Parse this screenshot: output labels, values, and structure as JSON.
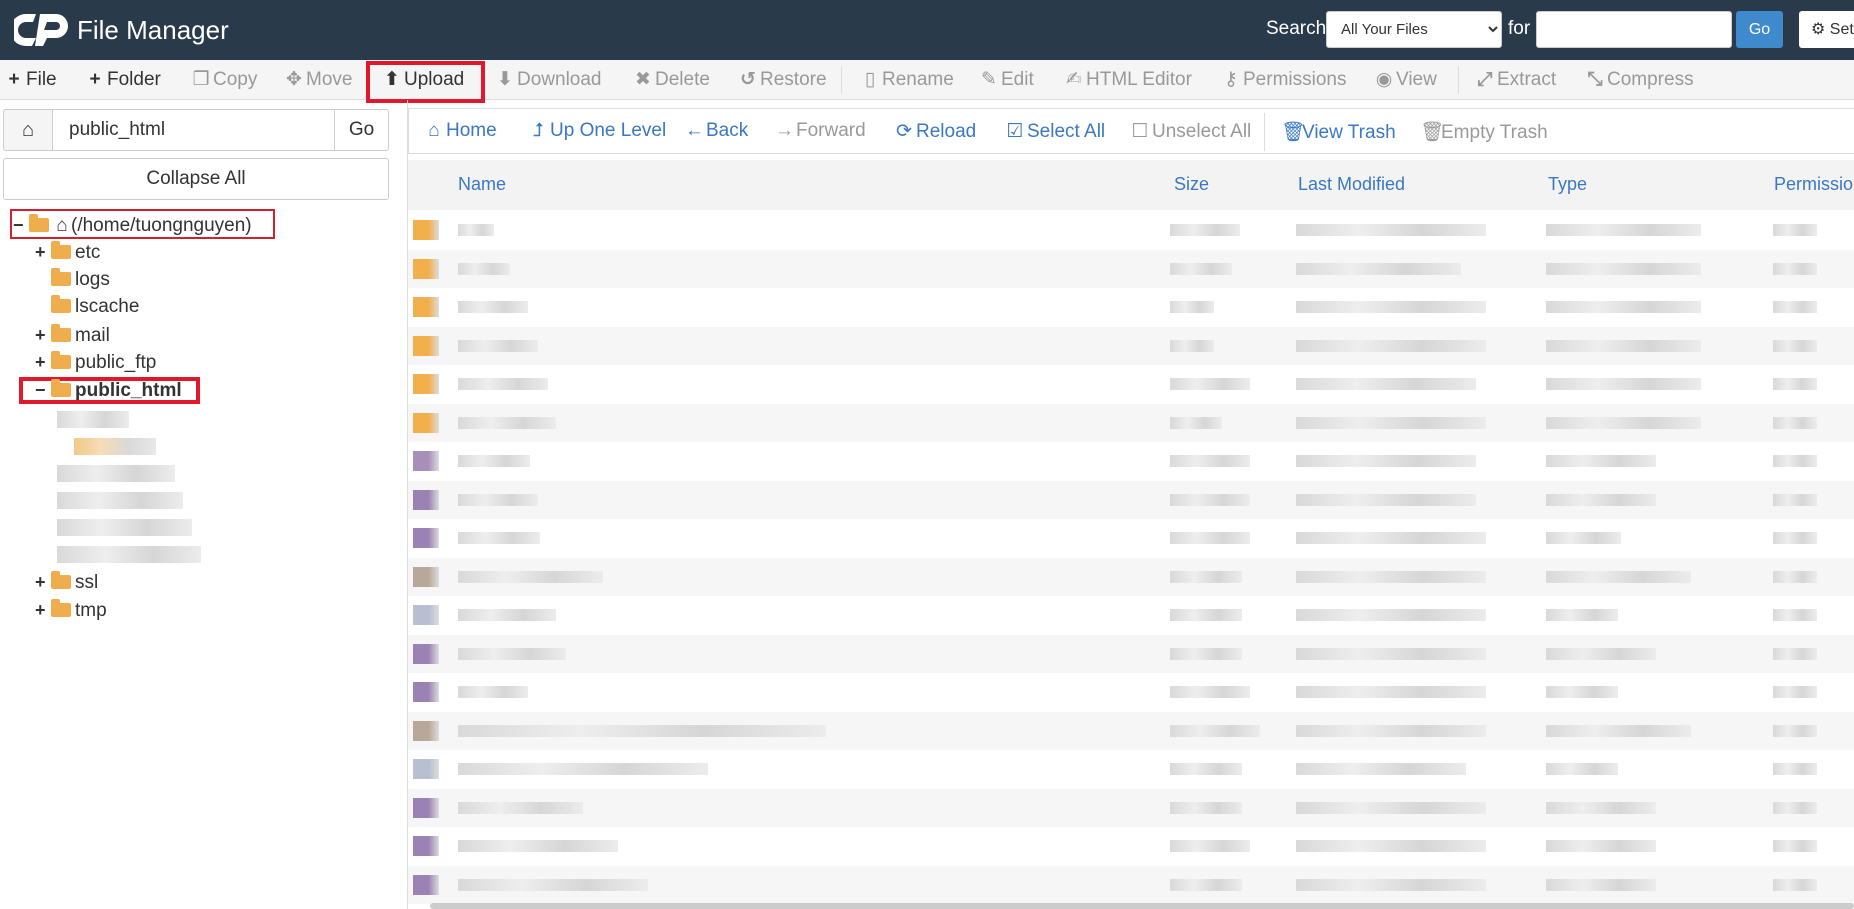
{
  "header": {
    "app_title": "File Manager",
    "search_label": "Search",
    "search_scope": "All Your Files",
    "for_label": "for",
    "search_value": "",
    "go_label": "Go",
    "settings_label": "Set"
  },
  "toolbar": {
    "file": "File",
    "folder": "Folder",
    "copy": "Copy",
    "move": "Move",
    "upload": "Upload",
    "download": "Download",
    "delete": "Delete",
    "restore": "Restore",
    "rename": "Rename",
    "edit": "Edit",
    "html_editor": "HTML Editor",
    "permissions": "Permissions",
    "view": "View",
    "extract": "Extract",
    "compress": "Compress"
  },
  "sidebar": {
    "path_value": "public_html",
    "go_label": "Go",
    "collapse_all": "Collapse All",
    "root_label": "(/home/tuongnguyen)",
    "items": [
      {
        "label": "etc",
        "toggle": "+"
      },
      {
        "label": "logs",
        "toggle": ""
      },
      {
        "label": "lscache",
        "toggle": ""
      },
      {
        "label": "mail",
        "toggle": "+"
      },
      {
        "label": "public_ftp",
        "toggle": "+"
      },
      {
        "label": "public_html",
        "toggle": "−"
      },
      {
        "label": "ssl",
        "toggle": "+"
      },
      {
        "label": "tmp",
        "toggle": "+"
      }
    ]
  },
  "nav": {
    "home": "Home",
    "up_one_level": "Up One Level",
    "back": "Back",
    "forward": "Forward",
    "reload": "Reload",
    "select_all": "Select All",
    "unselect_all": "Unselect All",
    "view_trash": "View Trash",
    "empty_trash": "Empty Trash"
  },
  "table": {
    "columns": [
      "Name",
      "Size",
      "Last Modified",
      "Type",
      "Permissions"
    ]
  },
  "colors": {
    "header_bg": "#293a4a",
    "link_blue": "#3a78c3",
    "highlight_red": "#e0182b",
    "folder_orange": "#f0ad4e"
  }
}
